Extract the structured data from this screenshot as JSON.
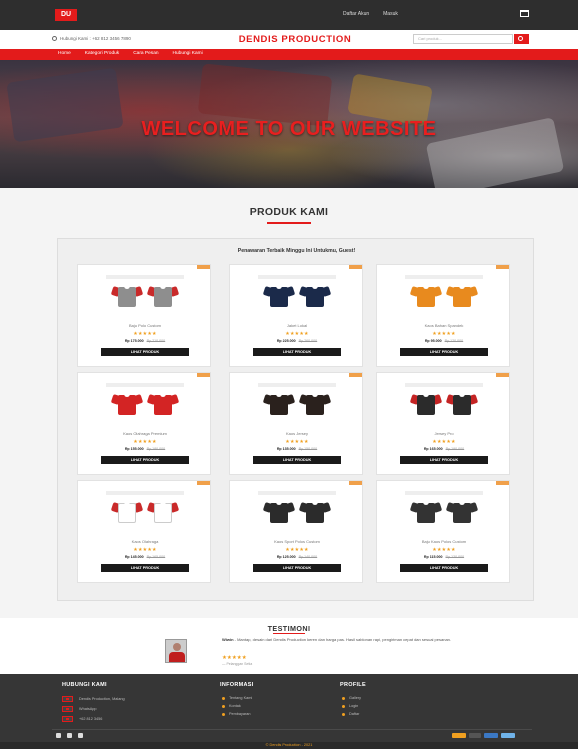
{
  "topbar": {
    "logo": "DU",
    "links": [
      "Daftar Akun",
      "Masuk"
    ]
  },
  "header": {
    "phone": "Hubungi Kami : +62 812 3456 7890",
    "brand": "DENDIS PRODUCTION",
    "search_placeholder": "Cari produk..."
  },
  "nav": {
    "items": [
      "Home",
      "Kategori Produk",
      "Cara Pesan",
      "Hubungi Kami"
    ]
  },
  "hero": {
    "title": "WELCOME TO OUR WEBSITE"
  },
  "products": {
    "section_title": "PRODUK KAMI",
    "box_subtitle": "Penawaran Terbaik Minggu Ini Untukmu, Guest!",
    "buy_label": "LIHAT PRODUK",
    "items": [
      {
        "name": "Baju Polo Custom",
        "stars": "★★★★★",
        "price": "Rp 175.000",
        "old_price": "Rp 210.000",
        "colors": {
          "body": "#8e8e8e",
          "sleeve": "#c92a2a"
        }
      },
      {
        "name": "Jaket Lokal",
        "stars": "★★★★★",
        "price": "Rp 225.000",
        "old_price": "Rp 260.000",
        "colors": {
          "body": "#1b2a4a",
          "sleeve": "#1b2a4a"
        }
      },
      {
        "name": "Kaos Bahan Spandek",
        "stars": "★★★★★",
        "price": "Rp 95.000",
        "old_price": "Rp 120.000",
        "colors": {
          "body": "#e88a1e",
          "sleeve": "#e88a1e"
        }
      },
      {
        "name": "Kaos Olahraga Premium",
        "stars": "★★★★★",
        "price": "Rp 155.000",
        "old_price": "Rp 180.000",
        "colors": {
          "body": "#d32424",
          "sleeve": "#d32424"
        }
      },
      {
        "name": "Kaos Jersey",
        "stars": "★★★★★",
        "price": "Rp 135.000",
        "old_price": "Rp 150.000",
        "colors": {
          "body": "#2a211d",
          "sleeve": "#2a211d"
        }
      },
      {
        "name": "Jersey Pro",
        "stars": "★★★★★",
        "price": "Rp 165.000",
        "old_price": "Rp 190.000",
        "colors": {
          "body": "#2b2b2b",
          "sleeve": "#c42424"
        }
      },
      {
        "name": "Kaos Olahraga",
        "stars": "★★★★★",
        "price": "Rp 145.000",
        "old_price": "Rp 165.000",
        "colors": {
          "body": "#ffffff",
          "sleeve": "#c92a2a"
        }
      },
      {
        "name": "Kaos Sport Polos Custom",
        "stars": "★★★★★",
        "price": "Rp 125.000",
        "old_price": "Rp 140.000",
        "colors": {
          "body": "#2b2b2b",
          "sleeve": "#2b2b2b"
        }
      },
      {
        "name": "Baju Kaos Polos Custom",
        "stars": "★★★★★",
        "price": "Rp 115.000",
        "old_price": "Rp 130.000",
        "colors": {
          "body": "#333333",
          "sleeve": "#333333"
        }
      }
    ]
  },
  "testimoni": {
    "title": "TESTIMONI",
    "quote_author": "Wiwin",
    "quote": " - Mantap, desain dari Dendis Production keren dan harga pas. Hasil sablonan rapi, pengiriman cepat dan sesuai pesanan.",
    "stars": "★★★★★",
    "meta": "— Pelanggan Setia"
  },
  "footer": {
    "col1_title": "HUBUNGI KAMI",
    "contacts": [
      "Dendis Production, Malang",
      "WhatsApp",
      "+62 812 3456"
    ],
    "col2_title": "INFORMASI",
    "info_links": [
      "Tentang Kami",
      "Kontak",
      "Pembayaran"
    ],
    "col3_title": "PROFILE",
    "profile_links": [
      "Gallery",
      "Login",
      "Daftar"
    ],
    "copyright": "© Dendis Production - 2021"
  },
  "colors": {
    "brand_red": "#e31b1b",
    "accent_orange": "#f0a020",
    "dark": "#363636"
  }
}
